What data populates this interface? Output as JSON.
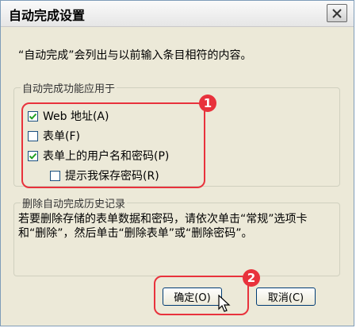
{
  "dialog": {
    "title": "自动完成设置",
    "intro": "“自动完成”会列出与以前输入条目相符的内容。",
    "apply_group": {
      "legend": "自动完成功能应用于",
      "options": [
        {
          "label": "Web 地址(A)",
          "checked": true
        },
        {
          "label": "表单(F)",
          "checked": false
        },
        {
          "label": "表单上的用户名和密码(P)",
          "checked": true
        },
        {
          "label": "提示我保存密码(R)",
          "checked": false
        }
      ]
    },
    "clear_group": {
      "legend": "删除自动完成历史记录",
      "text": "若要删除存储的表单数据和密码，请依次单击“常规”选项卡和“删除”，然后单击“删除表单”或“删除密码”。"
    },
    "buttons": {
      "ok": "确定(O)",
      "cancel": "取消(C)"
    },
    "annotations": {
      "marker1": "1",
      "marker2": "2"
    }
  }
}
